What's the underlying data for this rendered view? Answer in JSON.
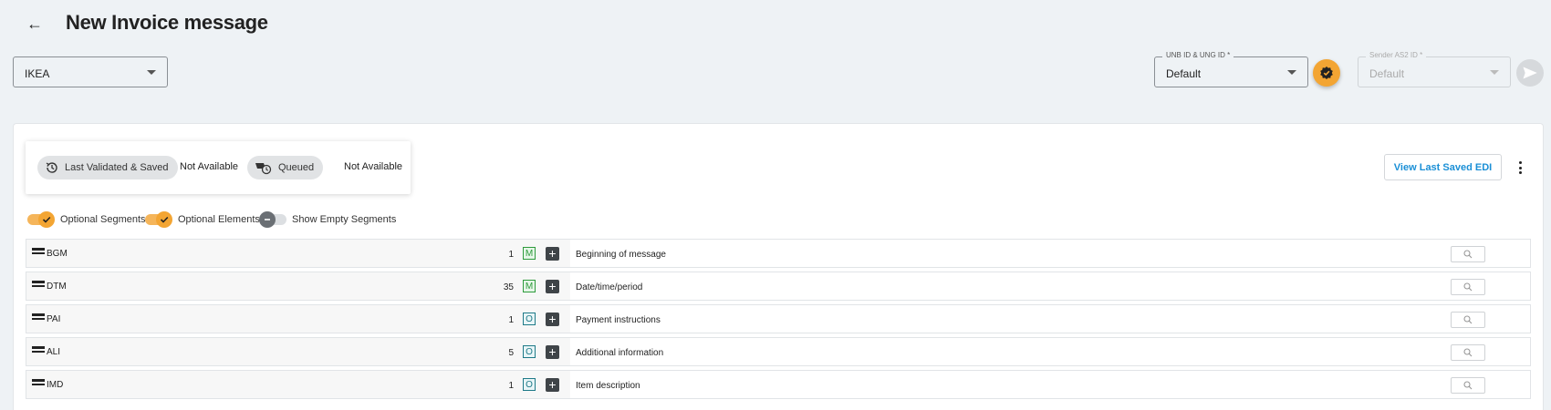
{
  "header": {
    "title": "New Invoice message"
  },
  "company_select": {
    "value": "IKEA"
  },
  "unb_select": {
    "label": "UNB ID & UNG ID *",
    "value": "Default"
  },
  "sender_select": {
    "label": "Sender AS2 ID *",
    "value": "Default"
  },
  "status": {
    "validated_label": "Last Validated & Saved",
    "validated_value": "Not Available",
    "queued_label": "Queued",
    "queued_value": "Not Available"
  },
  "actions": {
    "view_edi_label": "View Last Saved EDI"
  },
  "toggles": [
    {
      "label": "Optional Segments",
      "on": true
    },
    {
      "label": "Optional Elements",
      "on": true
    },
    {
      "label": "Show Empty Segments",
      "on": false
    }
  ],
  "segments": [
    {
      "code": "BGM",
      "count": "1",
      "status": "M",
      "description": "Beginning of message"
    },
    {
      "code": "DTM",
      "count": "35",
      "status": "M",
      "description": "Date/time/period"
    },
    {
      "code": "PAI",
      "count": "1",
      "status": "O",
      "description": "Payment instructions"
    },
    {
      "code": "ALI",
      "count": "5",
      "status": "O",
      "description": "Additional information"
    },
    {
      "code": "IMD",
      "count": "1",
      "status": "O",
      "description": "Item description"
    }
  ],
  "colors": {
    "accent": "#f3a533",
    "link": "#1a8fd6",
    "mandatory": "#2e9b3c",
    "optional": "#1e7a88"
  }
}
